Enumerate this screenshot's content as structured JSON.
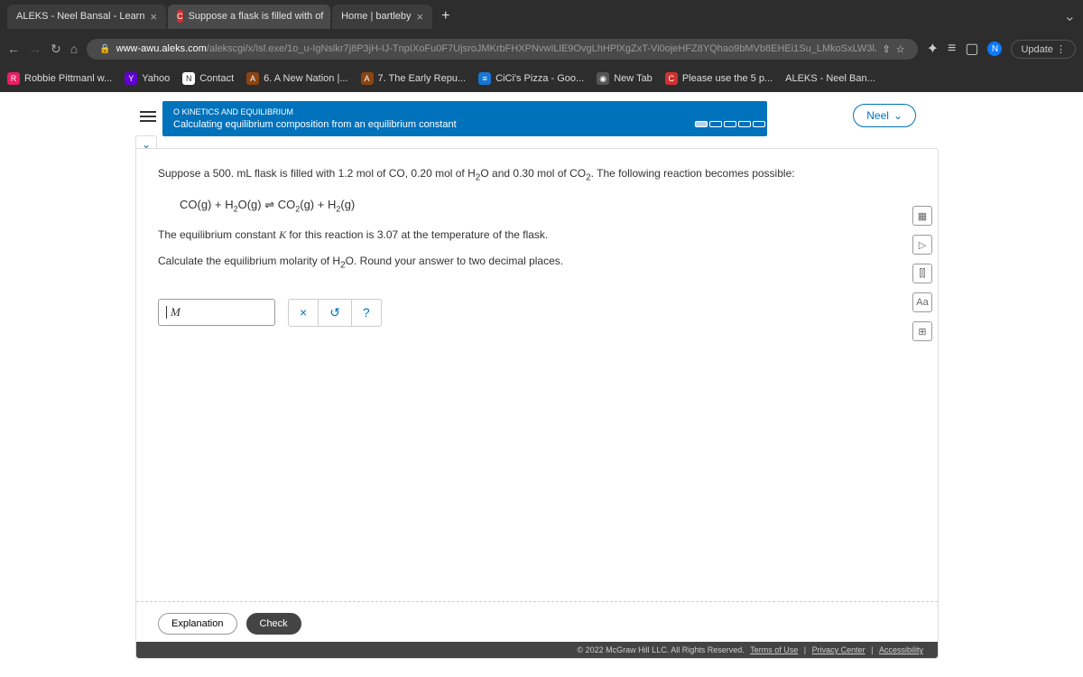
{
  "tabs": [
    {
      "label": "ALEKS - Neel Bansal - Learn",
      "icon": "A"
    },
    {
      "label": "Suppose a flask is filled with of",
      "icon": "C"
    },
    {
      "label": "Home | bartleby",
      "icon": "b"
    }
  ],
  "url": {
    "domain": "www-awu.aleks.com",
    "path": "/alekscgi/x/Isl.exe/1o_u-IgNslkr7j8P3jH-IJ-TnpIXoFu0F7UjsroJMKrbFHXPNvwILlE9OvgLhHPlXgZxT-Vi0ojeHFZ8YQhao9bMVb8EHEi1Su_LMkoSxLW3lJjpayq?1oBw7QYjlbavbSPXt..."
  },
  "update_label": "Update",
  "bookmarks": [
    {
      "label": "Robbie Pittmanl w...",
      "icon": "R",
      "cls": "bk-r"
    },
    {
      "label": "Yahoo",
      "icon": "Y",
      "cls": "bk-y"
    },
    {
      "label": "Contact",
      "icon": "N",
      "cls": "bk-n"
    },
    {
      "label": "6. A New Nation |...",
      "icon": "A",
      "cls": "bk-a"
    },
    {
      "label": "7. The Early Repu...",
      "icon": "A",
      "cls": "bk-a"
    },
    {
      "label": "CiCi's Pizza - Goo...",
      "icon": "≡",
      "cls": "bk-c"
    },
    {
      "label": "New Tab",
      "icon": "◉",
      "cls": "bk-g"
    },
    {
      "label": "Please use the 5 p...",
      "icon": "C",
      "cls": "bk-p"
    },
    {
      "label": "ALEKS - Neel Ban...",
      "icon": "A",
      "cls": "bk-a"
    }
  ],
  "module": {
    "topic": "O KINETICS AND EQUILIBRIUM",
    "title": "Calculating equilibrium composition from an equilibrium constant",
    "progress": "0/5"
  },
  "user_label": "Neel",
  "question": {
    "line1_a": "Suppose a ",
    "vol": "500. mL",
    "line1_b": " flask is filled with ",
    "n1": "1.2 mol",
    "of": " of ",
    "s1": "CO",
    "comma": ", ",
    "n2": "0.20 mol",
    "s2_a": "H",
    "s2_b": "O",
    "and": " and ",
    "n3": "0.30 mol",
    "s3_a": "CO",
    "line1_c": ". The following reaction becomes possible:",
    "eq_left_a": "CO(g) + H",
    "eq_left_b": "O(g)",
    "arrow": " ⇌ ",
    "eq_right_a": "CO",
    "eq_right_b": "(g) + H",
    "eq_right_c": "(g)",
    "line2_a": "The equilibrium constant ",
    "kval": "3.07",
    "line2_b": " for this reaction is ",
    "line2_c": " at the temperature of the flask.",
    "line3_a": "Calculate the equilibrium molarity of ",
    "line3_b": ". Round your answer to two decimal places."
  },
  "answer_unit": "M",
  "tools": {
    "clear": "×",
    "undo": "↺",
    "help": "?"
  },
  "side_tools": [
    "▦",
    "▷",
    "⫿⫿",
    "Aa",
    "⊞"
  ],
  "buttons": {
    "explanation": "Explanation",
    "check": "Check"
  },
  "footer": {
    "copyright": "© 2022 McGraw Hill LLC. All Rights Reserved.",
    "terms": "Terms of Use",
    "privacy": "Privacy Center",
    "access": "Accessibility"
  }
}
